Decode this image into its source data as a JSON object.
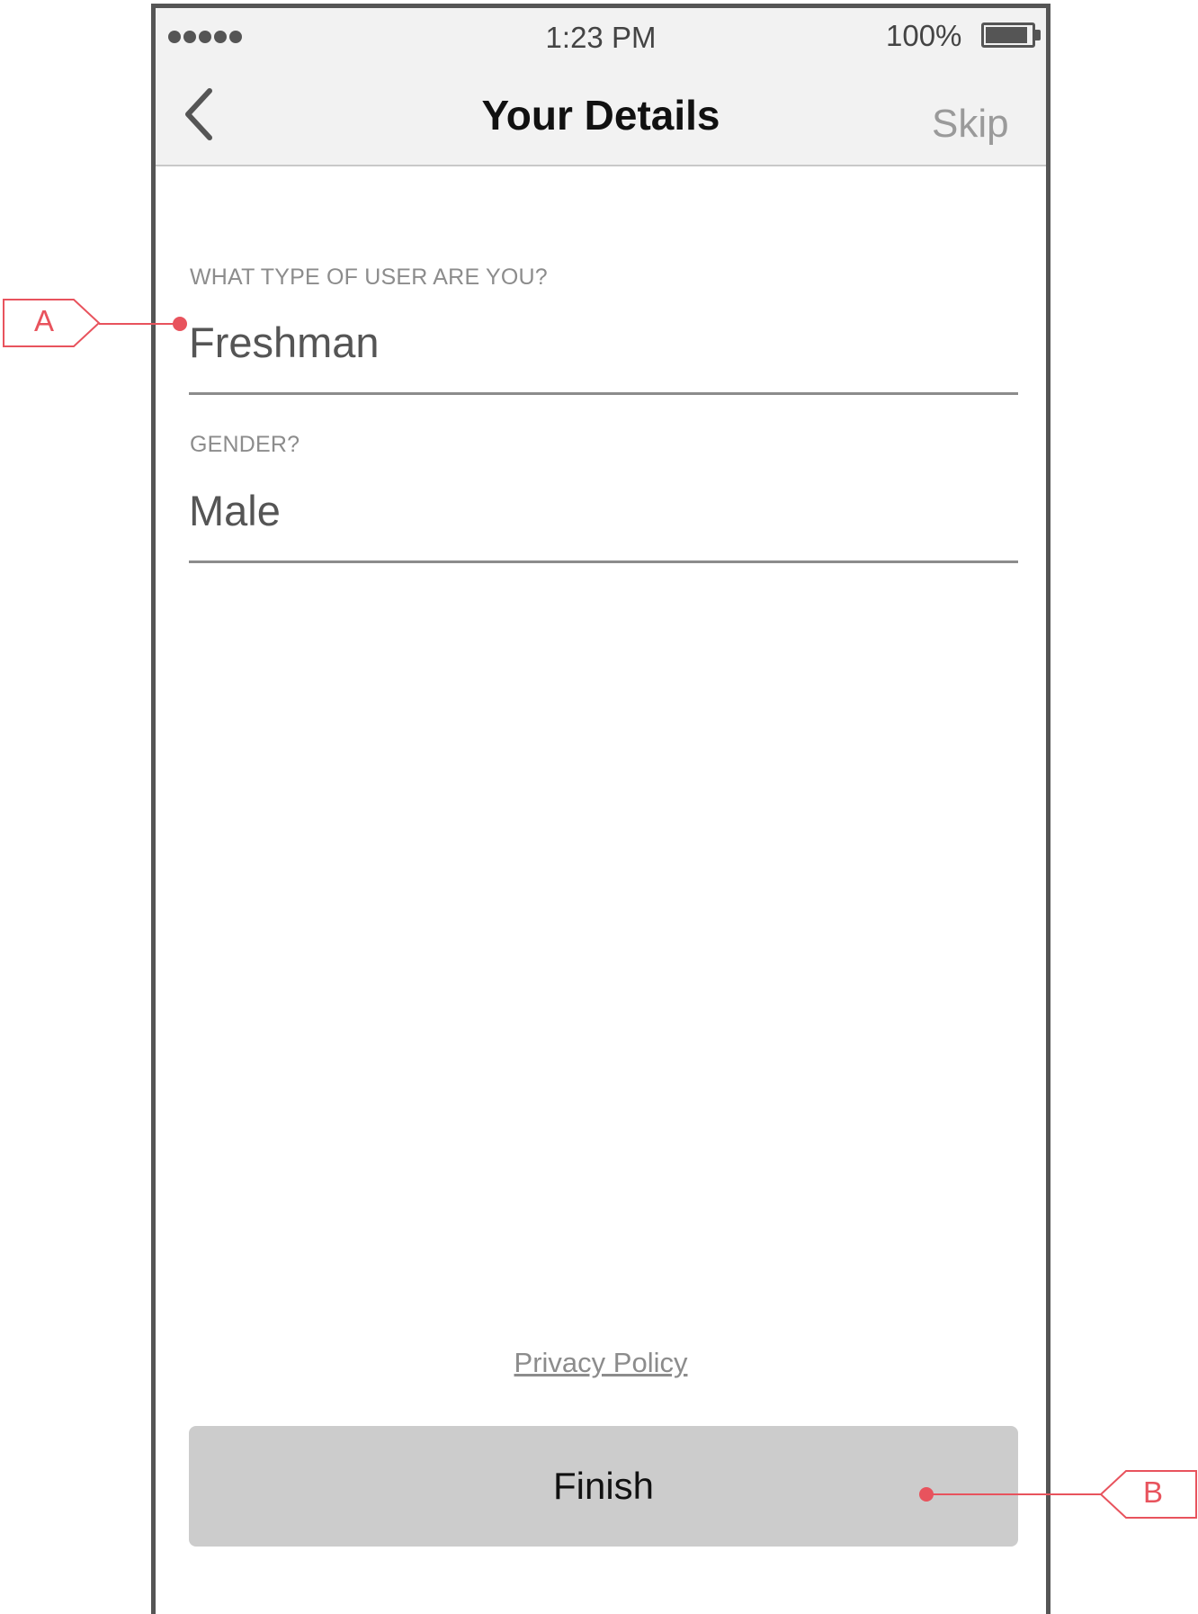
{
  "status_bar": {
    "signal_dots": 5,
    "time": "1:23 PM",
    "battery_percent": "100%",
    "battery_level": 0.85
  },
  "nav": {
    "back_icon": "chevron-left-icon",
    "title": "Your Details",
    "skip_label": "Skip"
  },
  "form": {
    "user_type": {
      "label": "WHAT TYPE OF USER ARE YOU?",
      "value": "Freshman"
    },
    "gender": {
      "label": "GENDER?",
      "value": "Male"
    }
  },
  "footer": {
    "privacy_link": "Privacy Policy",
    "finish_label": "Finish"
  },
  "annotations": {
    "a": "A",
    "b": "B",
    "color": "#e8535d"
  }
}
